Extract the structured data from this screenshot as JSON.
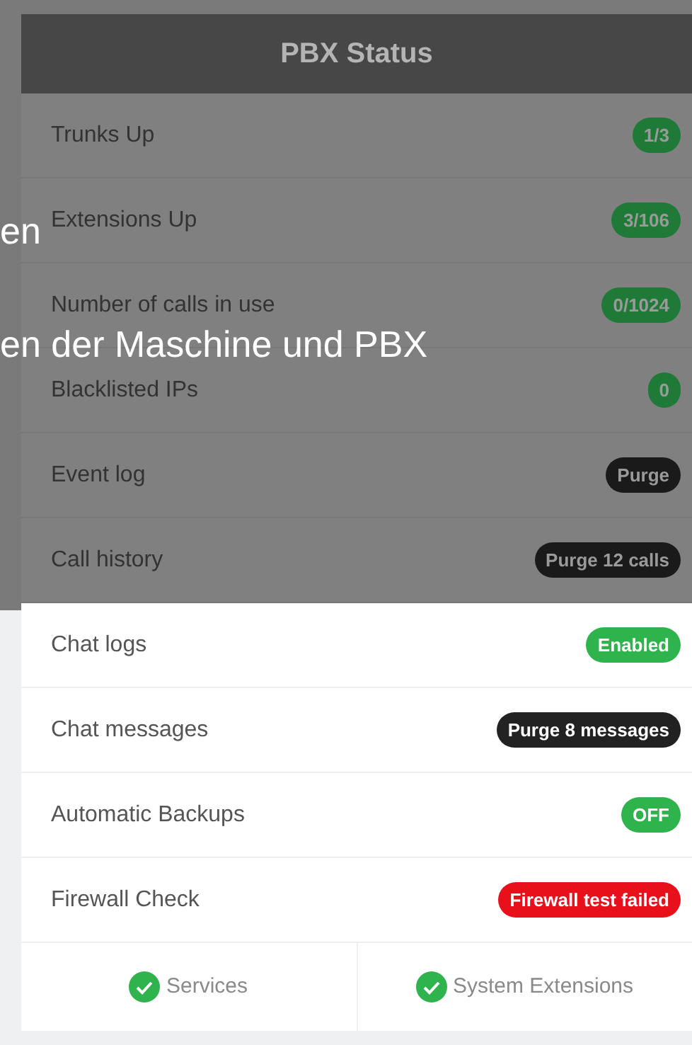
{
  "panel": {
    "title": "PBX Status"
  },
  "rows": [
    {
      "label": "Trunks Up",
      "badge": "1/3",
      "color": "#1e7a36",
      "dimmed": true
    },
    {
      "label": "Extensions Up",
      "badge": "3/106",
      "color": "#1e7a36",
      "dimmed": true
    },
    {
      "label": "Number of calls in use",
      "badge": "0/1024",
      "color": "#1e7a36",
      "dimmed": true
    },
    {
      "label": "Blacklisted IPs",
      "badge": "0",
      "color": "#1e7a36",
      "dimmed": true
    },
    {
      "label": "Event log",
      "badge": "Purge",
      "color": "#1a1a1a",
      "dimmed": true
    },
    {
      "label": "Call history",
      "badge": "Purge 12 calls",
      "color": "#1a1a1a",
      "dimmed": true
    },
    {
      "label": "Chat logs",
      "badge": "Enabled",
      "color": "#2fb34d",
      "dimmed": false
    },
    {
      "label": "Chat messages",
      "badge": "Purge 8 messages",
      "color": "#222222",
      "dimmed": false
    },
    {
      "label": "Automatic Backups",
      "badge": "OFF",
      "color": "#2fb34d",
      "dimmed": false
    },
    {
      "label": "Firewall Check",
      "badge": "Firewall test failed",
      "color": "#e8101a",
      "dimmed": false
    }
  ],
  "footer": [
    {
      "label": "Services",
      "ok": true
    },
    {
      "label": "System Extensions",
      "ok": true
    }
  ],
  "overlay": {
    "lines": [
      "en",
      "en der Maschine und PBX"
    ]
  }
}
